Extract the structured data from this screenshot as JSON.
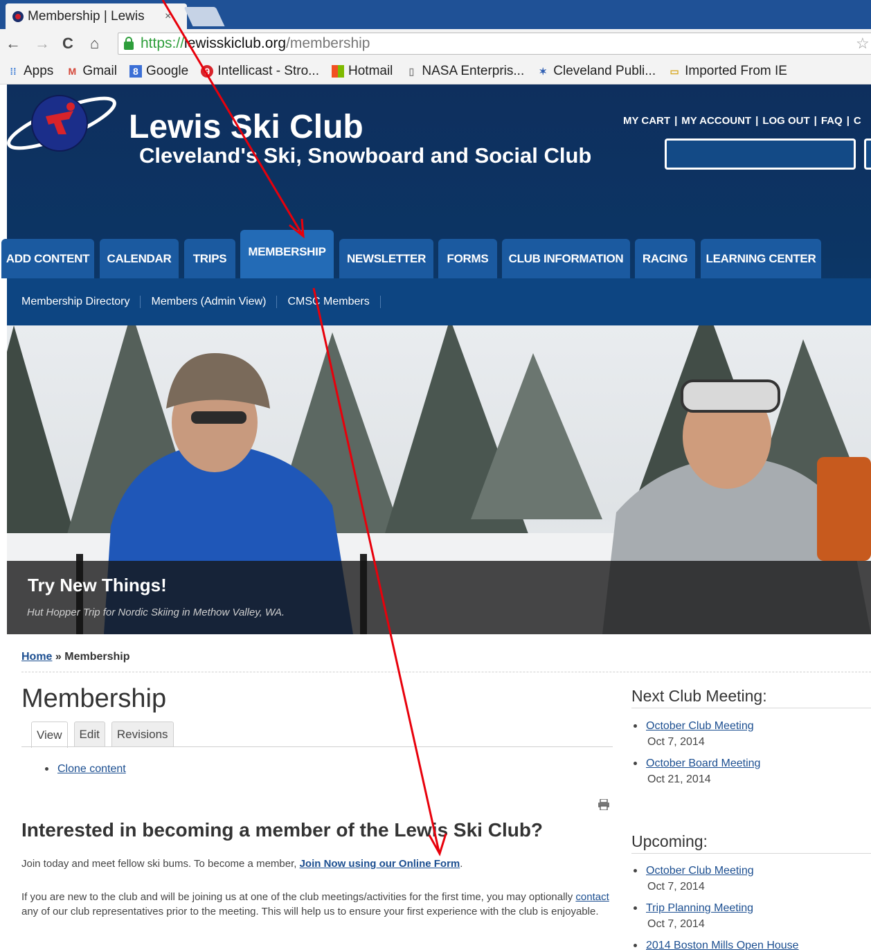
{
  "browser": {
    "tab_title": "Membership | Lewis",
    "tab_close": "×",
    "url_scheme": "https://",
    "url_host": "lewisskiclub.org",
    "url_path": "/membership",
    "bookmarks": [
      "Apps",
      "Gmail",
      "Google",
      "Intellicast - Stro...",
      "Hotmail",
      "NASA Enterpris...",
      "Cleveland Publi...",
      "Imported From IE"
    ]
  },
  "header": {
    "site_name": "Lewis Ski Club",
    "slogan": "Cleveland's Ski, Snowboard and Social Club",
    "user_links": [
      "MY CART",
      "MY ACCOUNT",
      "LOG OUT",
      "FAQ",
      "C"
    ],
    "separator": "|"
  },
  "nav": {
    "tabs": [
      "ADD CONTENT",
      "CALENDAR",
      "TRIPS",
      "MEMBERSHIP",
      "NEWSLETTER",
      "FORMS",
      "CLUB INFORMATION",
      "RACING",
      "LEARNING CENTER"
    ],
    "subnav": [
      "Membership Directory",
      "Members (Admin View)",
      "CMSC Members"
    ]
  },
  "hero": {
    "title": "Try New Things!",
    "subtitle": "Hut Hopper Trip for Nordic Skiing in Methow Valley, WA."
  },
  "breadcrumb": {
    "home": "Home",
    "sep": " » ",
    "current": "Membership"
  },
  "page": {
    "title": "Membership",
    "tabs": [
      "View",
      "Edit",
      "Revisions"
    ],
    "clone_link": "Clone content",
    "heading": "Interested in becoming a member of the Lewis Ski Club?",
    "para1_text": "Join today and meet fellow ski bums.  To become a member, ",
    "para1_link": "Join Now using our Online Form",
    "para1_end": ".",
    "para2_before": "If you are new to the club and will be joining us at one of the club meetings/activities for the first time, you may optionally ",
    "para2_link": "contact",
    "para2_after": " any of our club representatives prior to the meeting.  This will help us to ensure your first experience with the club is enjoyable."
  },
  "sidebar": {
    "next_title": "Next Club Meeting:",
    "next_events": [
      {
        "name": "October Club Meeting",
        "date": "Oct 7, 2014"
      },
      {
        "name": "October Board Meeting",
        "date": "Oct 21, 2014"
      }
    ],
    "upcoming_title": "Upcoming:",
    "upcoming_events": [
      {
        "name": "October Club Meeting",
        "date": "Oct 7, 2014"
      },
      {
        "name": "Trip Planning Meeting",
        "date": "Oct 7, 2014"
      },
      {
        "name": "2014 Boston Mills Open House",
        "date": ""
      }
    ]
  },
  "colors": {
    "header_bg": "#0c3564",
    "nav_tab": "#1b5aa0",
    "link": "#1b4e90",
    "annotation_arrow": "#e8000b"
  }
}
